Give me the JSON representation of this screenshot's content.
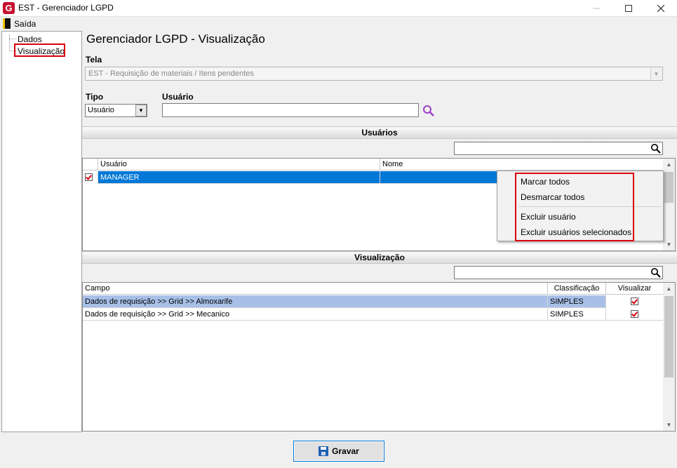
{
  "window": {
    "title": "EST - Gerenciador LGPD",
    "logo_letter": "G"
  },
  "menu": {
    "exit_label": "Saída"
  },
  "sidebar": {
    "items": [
      {
        "label": "Dados"
      },
      {
        "label": "Visualização",
        "selected": true
      }
    ]
  },
  "page": {
    "title": "Gerenciador LGPD - Visualização"
  },
  "form": {
    "screen_label": "Tela",
    "screen_value": "EST - Requisição de materiais / Itens pendentes",
    "type_label": "Tipo",
    "type_value": "Usuário",
    "user_label": "Usuário",
    "user_value": ""
  },
  "users_section": {
    "header": "Usuários",
    "filter_value": "",
    "columns": [
      "Usuário",
      "Nome"
    ],
    "rows": [
      {
        "checked": true,
        "usuario": "MANAGER",
        "nome": ""
      }
    ]
  },
  "context_menu": {
    "items": [
      "Marcar todos",
      "Desmarcar todos",
      "Excluir usuário",
      "Excluir usuários selecionados"
    ]
  },
  "view_section": {
    "header": "Visualização",
    "filter_value": "",
    "columns": [
      "Campo",
      "Classificação",
      "Visualizar"
    ],
    "rows": [
      {
        "campo": "Dados de requisição >> Grid >> Almoxarife",
        "classificacao": "SIMPLES",
        "visualizar": true
      },
      {
        "campo": "Dados de requisição >> Grid >> Mecanico",
        "classificacao": "SIMPLES",
        "visualizar": true
      }
    ]
  },
  "footer": {
    "save_label": "Gravar"
  },
  "colors": {
    "selection": "#0078d7",
    "row_highlight": "#a8c0e8",
    "annotation_red": "#d9000d",
    "search_purple": "#9b3fc8"
  }
}
